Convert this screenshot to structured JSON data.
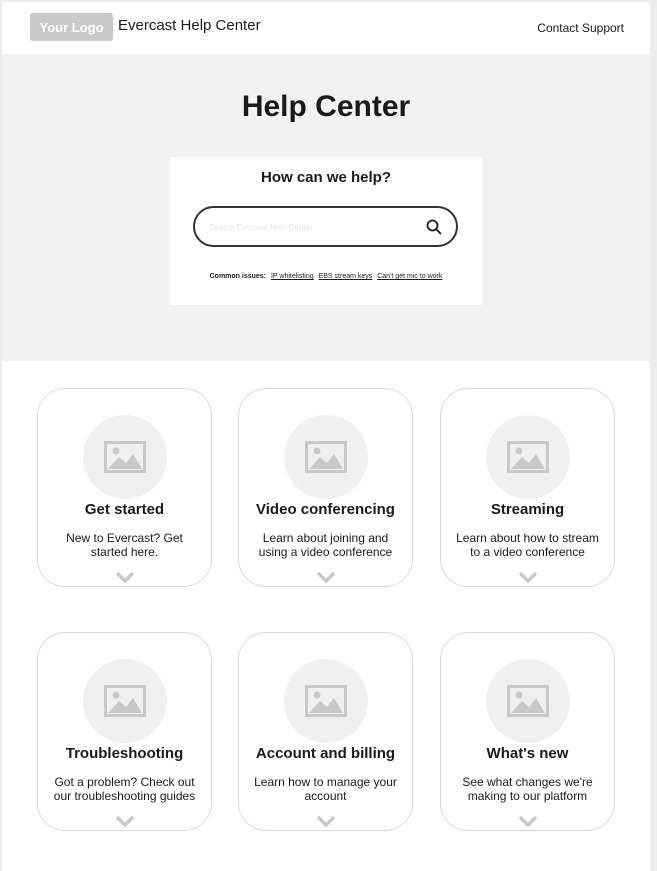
{
  "header": {
    "logo_text": "Your Logo",
    "site_title": "Evercast Help Center",
    "contact_label": "Contact Support"
  },
  "hero": {
    "title": "Help Center",
    "search_heading": "How can we help?",
    "search_placeholder": "Search Evercast Help Center",
    "common_label": "Common issues:",
    "common_links": [
      "IP whitelisting",
      "EBS stream keys",
      "Can't get mic to work"
    ]
  },
  "cards": [
    {
      "title": "Get started",
      "description": "New to Evercast? Get started here."
    },
    {
      "title": "Video conferencing",
      "description": "Learn about joining and using a video conference"
    },
    {
      "title": "Streaming",
      "description": "Learn about how to stream to a video conference"
    },
    {
      "title": "Troubleshooting",
      "description": "Got a problem? Check out our troubleshooting guides"
    },
    {
      "title": "Account and billing",
      "description": "Learn how to manage your account"
    },
    {
      "title": "What's new",
      "description": "See what changes we're making to our platform"
    }
  ],
  "icons": {
    "search": "search-icon",
    "card_image": "image-placeholder-icon",
    "expand": "chevron-down-icon"
  },
  "colors": {
    "hero_background": "#f2f2f2",
    "logo_background": "#c9c9c9",
    "placeholder_gray": "#c8c8c8"
  }
}
